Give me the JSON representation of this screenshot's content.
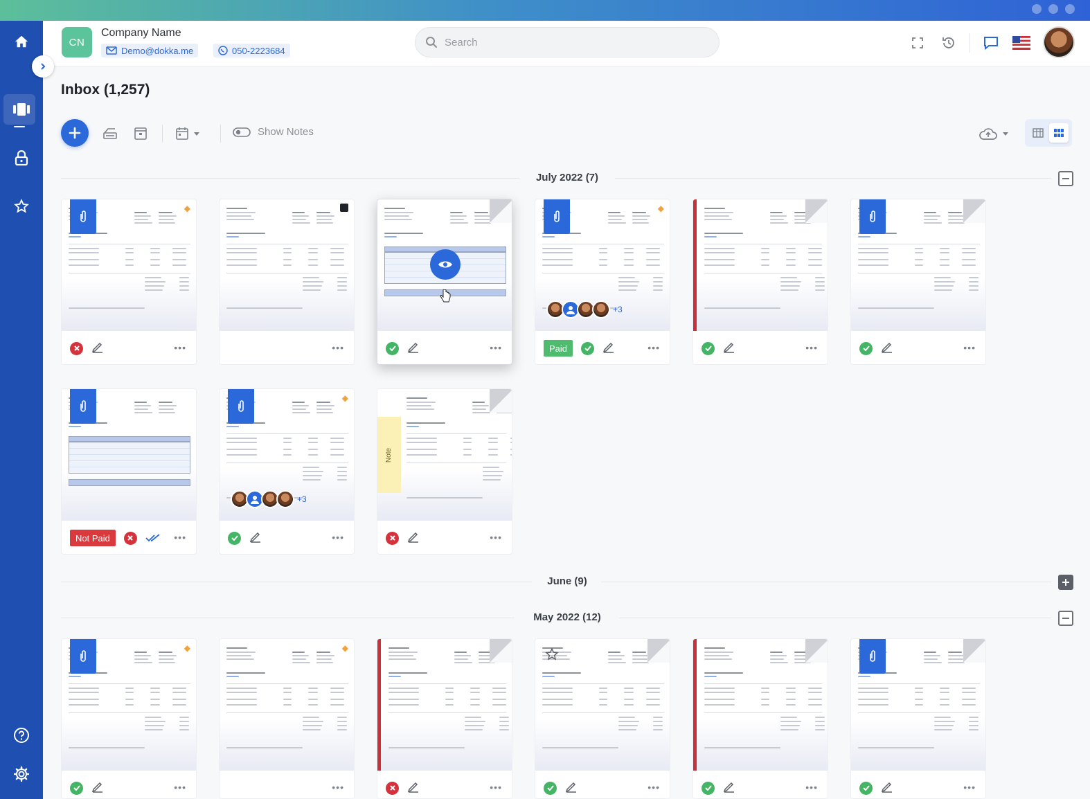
{
  "header": {
    "company_initials": "CN",
    "company_name": "Company Name",
    "email": "Demo@dokka.me",
    "phone": "050-2223684",
    "search_placeholder": "Search"
  },
  "page": {
    "title": "Inbox (1,257)"
  },
  "toolbar": {
    "show_notes_label": "Show Notes"
  },
  "groups": [
    {
      "label": "July 2022 (7)",
      "expanded": true
    },
    {
      "label": "June (9)",
      "expanded": false
    },
    {
      "label": "May 2022 (12)",
      "expanded": true
    }
  ],
  "badges": {
    "not_paid": "Not Paid",
    "paid": "Paid"
  },
  "cards": {
    "note_label": "Note",
    "more_avatars": "+3",
    "more_label": "•••"
  },
  "colors": {
    "sidebar": "#1f4fb0",
    "accent": "#2b68d9",
    "success": "#43b565",
    "error": "#d5323c",
    "company_avatar": "#5cc49b"
  }
}
